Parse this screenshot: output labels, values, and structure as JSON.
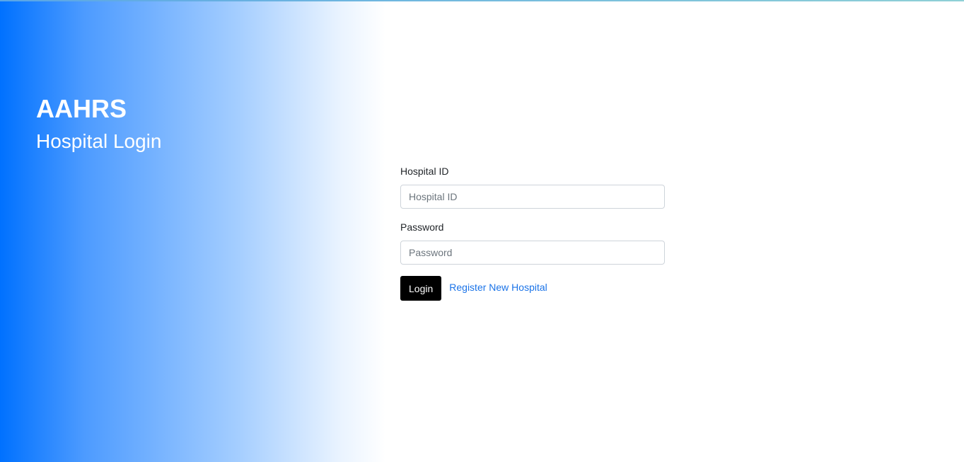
{
  "brand": {
    "title": "AAHRS",
    "subtitle": "Hospital Login"
  },
  "form": {
    "hospital_id": {
      "label": "Hospital ID",
      "placeholder": "Hospital ID",
      "value": ""
    },
    "password": {
      "label": "Password",
      "placeholder": "Password",
      "value": ""
    },
    "login_label": "Login",
    "register_label": "Register New Hospital"
  },
  "colors": {
    "brand_blue": "#0071ff",
    "link_blue": "#1a73e8",
    "button_black": "#000000"
  }
}
